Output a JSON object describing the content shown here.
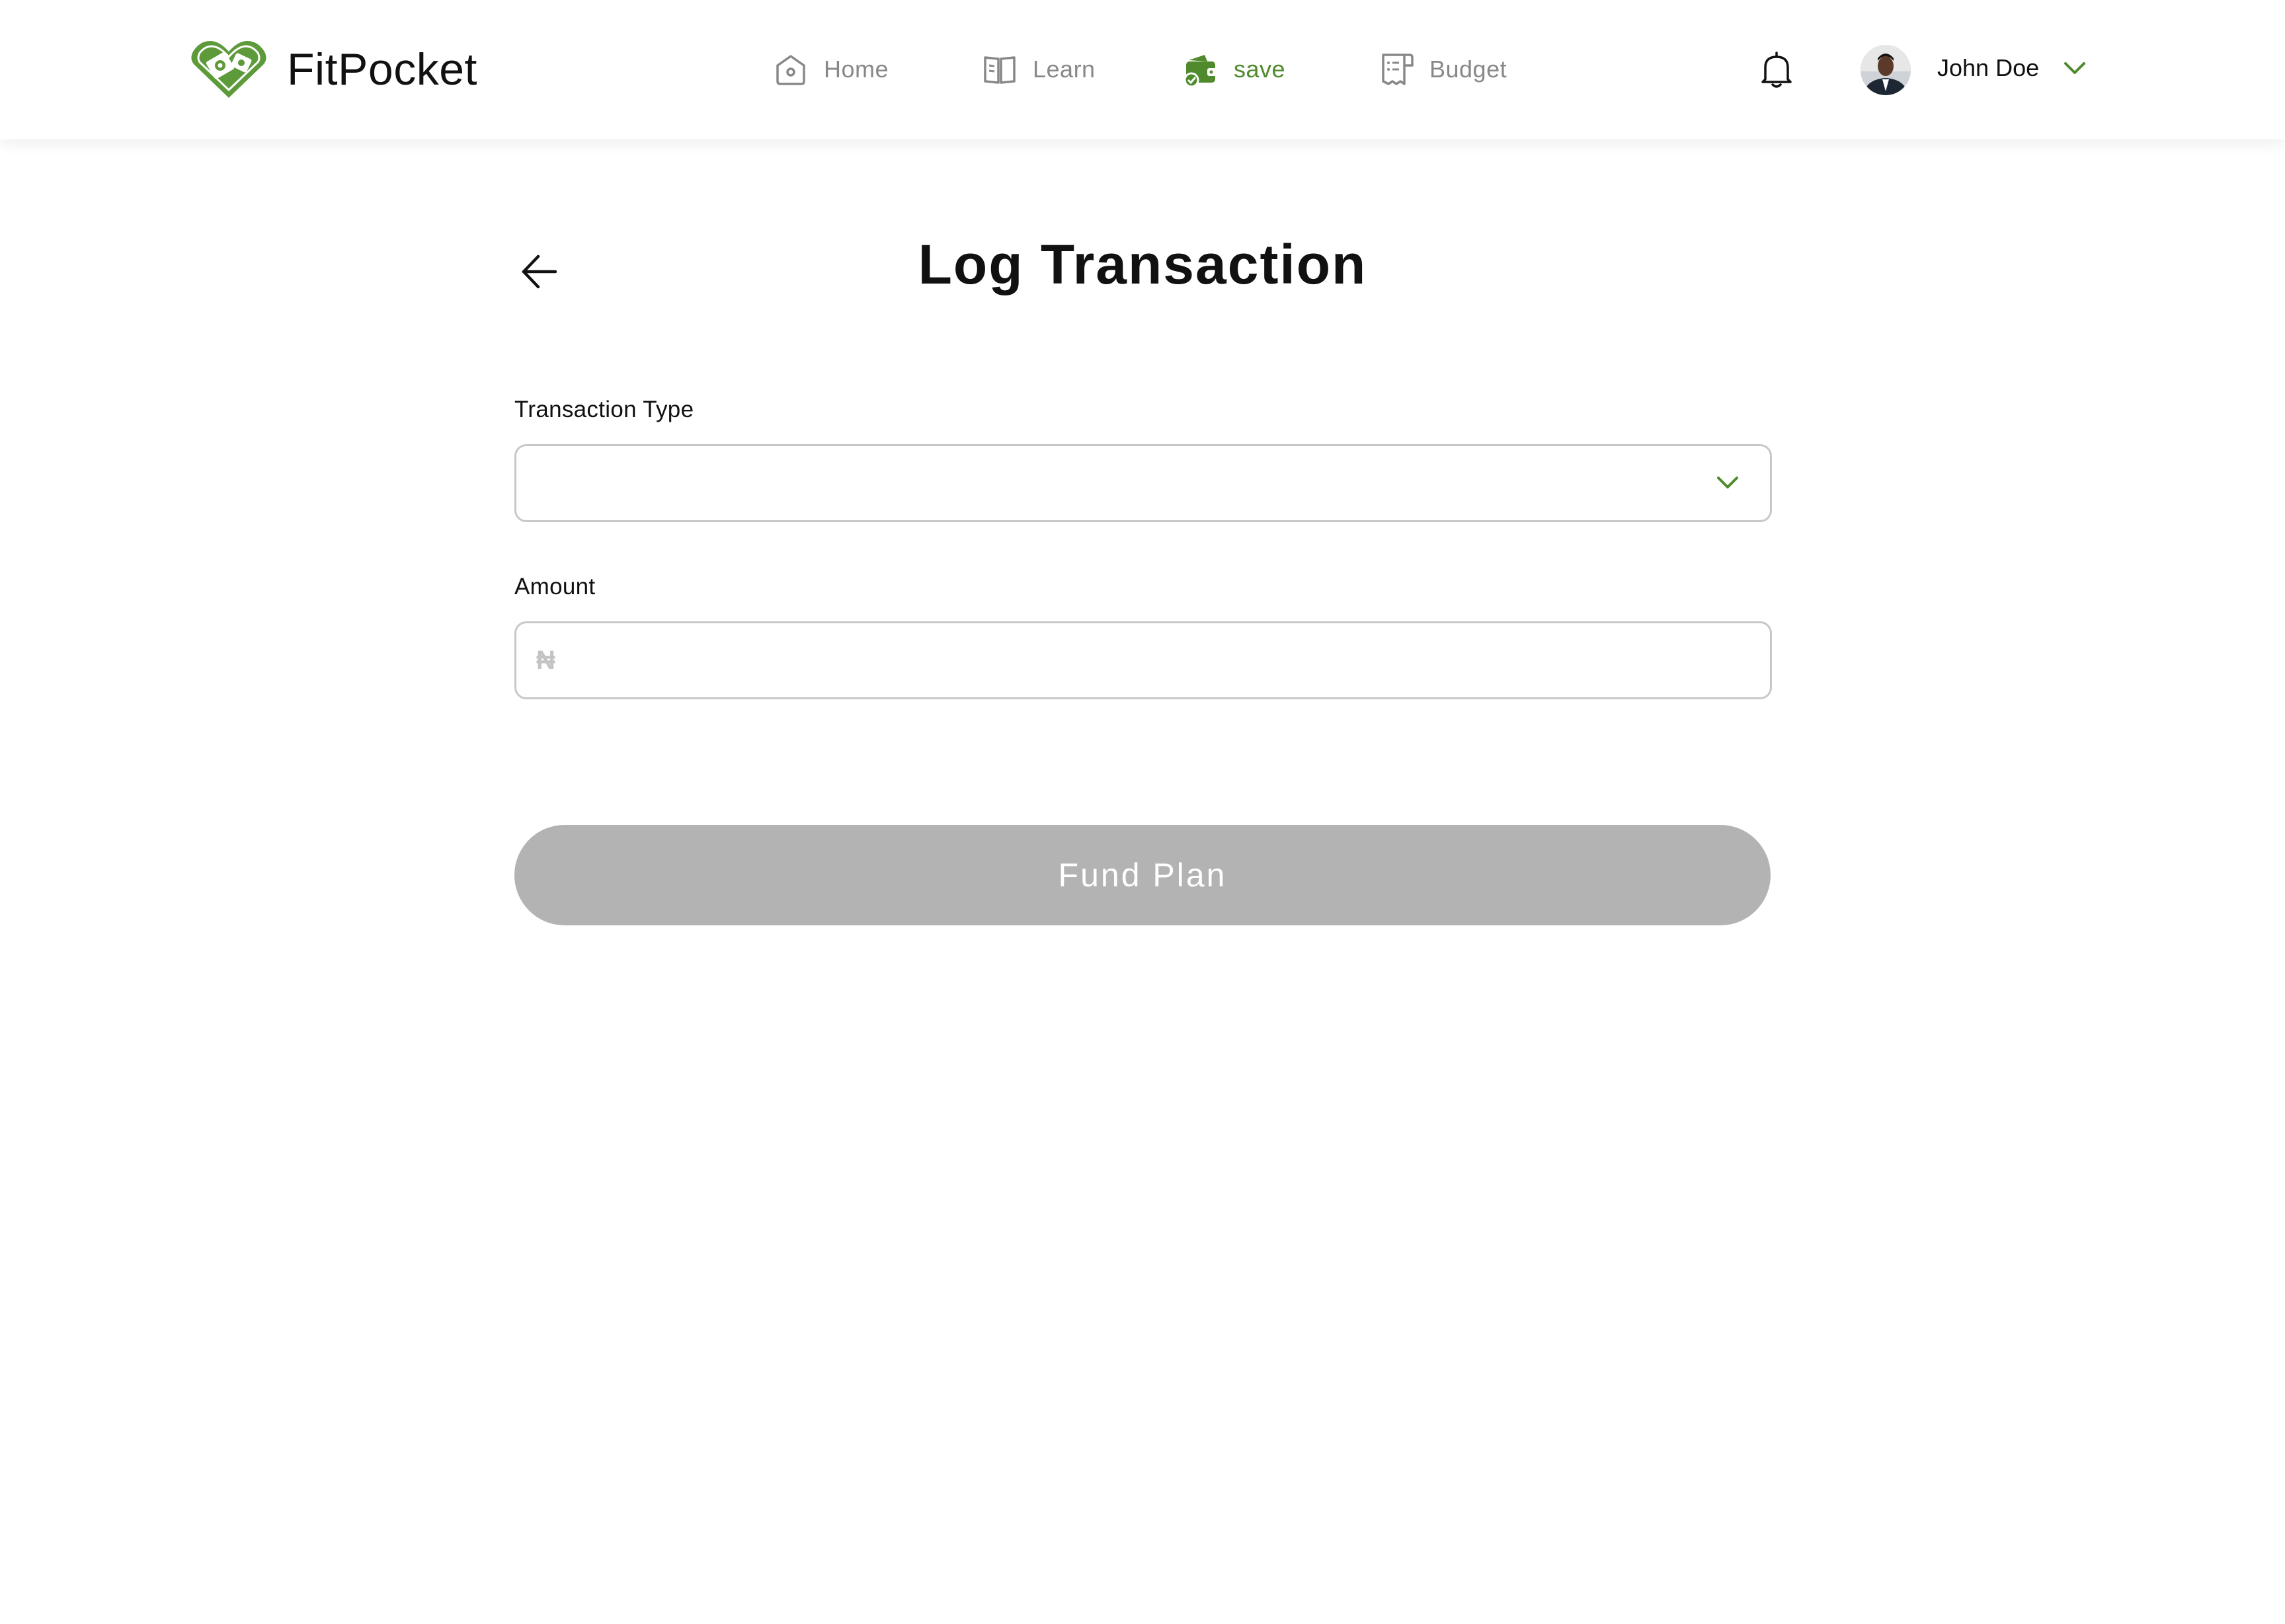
{
  "brand": {
    "name": "FitPocket",
    "accent_color": "#4f8a2c",
    "logo_icon": "money-heart-icon"
  },
  "nav": {
    "items": [
      {
        "label": "Home",
        "icon": "home-icon",
        "active": false
      },
      {
        "label": "Learn",
        "icon": "book-icon",
        "active": false
      },
      {
        "label": "save",
        "icon": "wallet-icon",
        "active": true
      },
      {
        "label": "Budget",
        "icon": "receipt-icon",
        "active": false
      }
    ]
  },
  "user": {
    "name": "John Doe",
    "notification_icon": "bell-icon",
    "menu_icon": "chevron-down-icon"
  },
  "page": {
    "title": "Log Transaction",
    "back_icon": "arrow-left-icon"
  },
  "form": {
    "transaction_type": {
      "label": "Transaction Type",
      "value": ""
    },
    "amount": {
      "label": "Amount",
      "placeholder": "₦",
      "value": ""
    },
    "submit_label": "Fund Plan",
    "submit_color": "#b3b3b3"
  }
}
